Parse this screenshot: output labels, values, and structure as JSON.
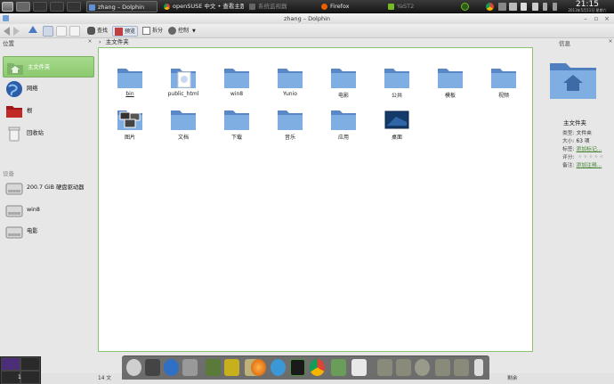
{
  "top_panel": {
    "tasks": [
      {
        "label": "zhang – Dolphin",
        "active": true
      },
      {
        "label": "openSUSE 中文 • 查看主题",
        "active": false
      },
      {
        "label": "系统监视器",
        "active": false
      },
      {
        "label": "Firefox",
        "active": false
      },
      {
        "label": "YaST2",
        "active": false
      }
    ],
    "clock_time": "21:15",
    "clock_date": "2013年5月11日 星期六"
  },
  "window": {
    "title": "zhang – Dolphin"
  },
  "toolbar": {
    "find_label": "查找",
    "preview_label": "预览",
    "split_label": "拆分",
    "control_label": "控制"
  },
  "places": {
    "header": "位置",
    "items": [
      {
        "label": "主文件夹",
        "icon": "home-folder-icon",
        "selected": true
      },
      {
        "label": "网络",
        "icon": "network-globe-icon",
        "selected": false
      },
      {
        "label": "根",
        "icon": "root-folder-icon",
        "selected": false
      },
      {
        "label": "回收站",
        "icon": "trash-icon",
        "selected": false
      }
    ],
    "devices_header": "设备",
    "devices": [
      {
        "label": "200.7 GiB 硬盘驱动器",
        "icon": "harddisk-icon"
      },
      {
        "label": "win8",
        "icon": "harddisk-icon"
      },
      {
        "label": "电影",
        "icon": "harddisk-icon"
      }
    ]
  },
  "breadcrumb": {
    "current": "主文件夹"
  },
  "files": [
    {
      "name": "bin",
      "kind": "folder"
    },
    {
      "name": "public_html",
      "kind": "folder-doc"
    },
    {
      "name": "win8",
      "kind": "folder"
    },
    {
      "name": "Yunio",
      "kind": "folder"
    },
    {
      "name": "电影",
      "kind": "folder"
    },
    {
      "name": "公共",
      "kind": "folder"
    },
    {
      "name": "模板",
      "kind": "folder"
    },
    {
      "name": "视频",
      "kind": "folder"
    },
    {
      "name": "图片",
      "kind": "folder-thumb"
    },
    {
      "name": "文档",
      "kind": "folder"
    },
    {
      "name": "下载",
      "kind": "folder"
    },
    {
      "name": "音乐",
      "kind": "folder"
    },
    {
      "name": "应用",
      "kind": "folder"
    },
    {
      "name": "桌面",
      "kind": "desktop"
    }
  ],
  "info_panel": {
    "title": "信息",
    "name": "主文件夹",
    "type_label": "类型:",
    "type_value": "文件夹",
    "size_label": "大小:",
    "size_value": "63 项",
    "tags_label": "标签:",
    "tags_link": "添加标记...",
    "rating_label": "评分:",
    "comment_label": "备注:",
    "comment_link": "添加注释..."
  },
  "statusbar": {
    "left": "14 文",
    "right": "剩余"
  },
  "pager": {
    "active_desktop": "1"
  },
  "colors": {
    "accent_green": "#8cc96f",
    "folder_blue": "#6f9fd6",
    "panel_dark": "#1b1b1b"
  }
}
